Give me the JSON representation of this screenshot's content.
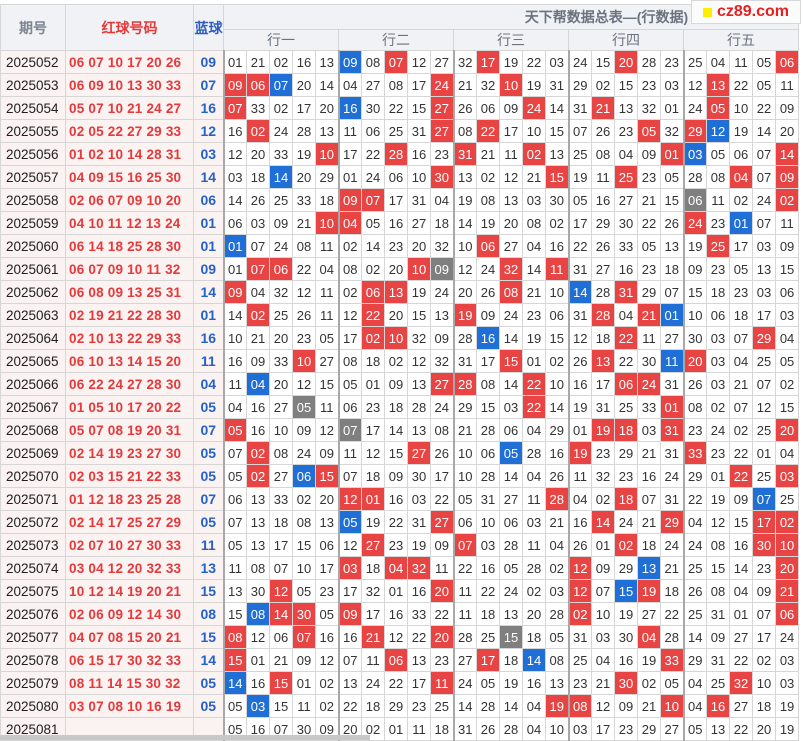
{
  "logo_text": "cz89.com",
  "header": {
    "period": "期号",
    "reds": "红球号码",
    "blue": "蓝球",
    "title": "天下帮数据总表—(行数据)",
    "groups": [
      "行一",
      "行二",
      "行三",
      "行四",
      "行五"
    ]
  },
  "rows": [
    {
      "period": "2025052",
      "reds": "06 07 10 17 20 26",
      "blue": "09",
      "cells": [
        "01",
        "21",
        "02",
        "16",
        "13",
        "09",
        "08",
        "07",
        "12",
        "27",
        "32",
        "17",
        "19",
        "22",
        "03",
        "24",
        "15",
        "20",
        "28",
        "23",
        "25",
        "04",
        "11",
        "05",
        "06"
      ],
      "marks": {
        "5": "b",
        "7": "r",
        "11": "r",
        "17": "r",
        "24": "r"
      }
    },
    {
      "period": "2025053",
      "reds": "06 09 10 13 30 33",
      "blue": "07",
      "cells": [
        "09",
        "06",
        "07",
        "20",
        "14",
        "04",
        "27",
        "08",
        "17",
        "24",
        "21",
        "32",
        "10",
        "19",
        "31",
        "29",
        "02",
        "15",
        "23",
        "03",
        "12",
        "13",
        "22",
        "05",
        "11"
      ],
      "marks": {
        "0": "r",
        "1": "r",
        "2": "b",
        "9": "r",
        "12": "r",
        "21": "r"
      }
    },
    {
      "period": "2025054",
      "reds": "05 07 10 21 24 27",
      "blue": "16",
      "cells": [
        "07",
        "33",
        "02",
        "17",
        "20",
        "16",
        "30",
        "22",
        "15",
        "27",
        "26",
        "06",
        "09",
        "24",
        "14",
        "31",
        "21",
        "13",
        "32",
        "01",
        "24",
        "05",
        "10",
        "22",
        "09"
      ],
      "marks": {
        "0": "r",
        "5": "b",
        "9": "r",
        "13": "r",
        "16": "r",
        "21": "r"
      }
    },
    {
      "period": "2025055",
      "reds": "02 05 22 27 29 33",
      "blue": "12",
      "cells": [
        "16",
        "02",
        "24",
        "28",
        "13",
        "11",
        "06",
        "25",
        "31",
        "27",
        "08",
        "22",
        "17",
        "10",
        "15",
        "07",
        "26",
        "23",
        "05",
        "32",
        "29",
        "12",
        "19",
        "14",
        "20"
      ],
      "marks": {
        "1": "r",
        "9": "r",
        "11": "r",
        "18": "r",
        "20": "r",
        "21": "b"
      }
    },
    {
      "period": "2025056",
      "reds": "01 02 10 14 28 31",
      "blue": "03",
      "cells": [
        "12",
        "20",
        "33",
        "19",
        "10",
        "17",
        "22",
        "28",
        "16",
        "23",
        "31",
        "21",
        "11",
        "02",
        "13",
        "25",
        "08",
        "04",
        "09",
        "01",
        "03",
        "05",
        "06",
        "07",
        "14"
      ],
      "marks": {
        "4": "r",
        "7": "r",
        "10": "r",
        "13": "r",
        "19": "r",
        "20": "b",
        "24": "r"
      }
    },
    {
      "period": "2025057",
      "reds": "04 09 15 16 25 30",
      "blue": "14",
      "cells": [
        "03",
        "18",
        "14",
        "20",
        "29",
        "01",
        "24",
        "06",
        "10",
        "30",
        "13",
        "02",
        "12",
        "21",
        "15",
        "19",
        "11",
        "25",
        "23",
        "05",
        "28",
        "08",
        "04",
        "07",
        "09"
      ],
      "marks": {
        "2": "b",
        "9": "r",
        "14": "r",
        "17": "r",
        "22": "r",
        "24": "r"
      }
    },
    {
      "period": "2025058",
      "reds": "02 06 07 09 10 20",
      "blue": "06",
      "cells": [
        "14",
        "26",
        "25",
        "33",
        "18",
        "09",
        "07",
        "17",
        "31",
        "04",
        "19",
        "08",
        "13",
        "03",
        "30",
        "05",
        "16",
        "27",
        "21",
        "15",
        "06",
        "11",
        "02",
        "24",
        "02"
      ],
      "marks": {
        "5": "r",
        "6": "r",
        "20": "g",
        "24": "r"
      }
    },
    {
      "period": "2025059",
      "reds": "04 10 11 12 13 24",
      "blue": "01",
      "cells": [
        "06",
        "03",
        "09",
        "21",
        "10",
        "04",
        "05",
        "16",
        "27",
        "18",
        "14",
        "19",
        "20",
        "08",
        "02",
        "17",
        "29",
        "30",
        "22",
        "26",
        "24",
        "23",
        "01",
        "07",
        "11"
      ],
      "marks": {
        "4": "r",
        "5": "r",
        "20": "r",
        "22": "b"
      }
    },
    {
      "period": "2025060",
      "reds": "06 14 18 25 28 30",
      "blue": "01",
      "cells": [
        "01",
        "07",
        "24",
        "08",
        "11",
        "02",
        "14",
        "23",
        "20",
        "32",
        "10",
        "06",
        "27",
        "04",
        "16",
        "22",
        "26",
        "33",
        "05",
        "13",
        "19",
        "25",
        "17",
        "03",
        "09"
      ],
      "marks": {
        "0": "b",
        "11": "r",
        "21": "r"
      }
    },
    {
      "period": "2025061",
      "reds": "06 07 09 10 11 32",
      "blue": "09",
      "cells": [
        "01",
        "07",
        "06",
        "22",
        "04",
        "08",
        "02",
        "20",
        "10",
        "09",
        "12",
        "24",
        "32",
        "14",
        "11",
        "31",
        "27",
        "16",
        "23",
        "18",
        "09",
        "23",
        "05",
        "13",
        "15"
      ],
      "marks": {
        "1": "r",
        "2": "r",
        "8": "r",
        "9": "g",
        "12": "r",
        "14": "r"
      }
    },
    {
      "period": "2025062",
      "reds": "06 08 09 13 25 31",
      "blue": "14",
      "cells": [
        "09",
        "04",
        "32",
        "12",
        "11",
        "02",
        "06",
        "13",
        "19",
        "24",
        "20",
        "26",
        "08",
        "21",
        "10",
        "14",
        "28",
        "31",
        "29",
        "07",
        "15",
        "18",
        "23",
        "03",
        "06"
      ],
      "marks": {
        "0": "r",
        "6": "r",
        "7": "r",
        "12": "r",
        "15": "b",
        "17": "r"
      }
    },
    {
      "period": "2025063",
      "reds": "02 19 21 22 28 30",
      "blue": "01",
      "cells": [
        "14",
        "02",
        "25",
        "26",
        "11",
        "12",
        "22",
        "20",
        "15",
        "13",
        "19",
        "09",
        "24",
        "23",
        "06",
        "31",
        "28",
        "04",
        "21",
        "01",
        "10",
        "06",
        "18",
        "17",
        "03"
      ],
      "marks": {
        "1": "r",
        "6": "r",
        "10": "r",
        "16": "r",
        "18": "r",
        "19": "b"
      }
    },
    {
      "period": "2025064",
      "reds": "02 10 13 22 29 33",
      "blue": "16",
      "cells": [
        "10",
        "21",
        "20",
        "23",
        "05",
        "17",
        "02",
        "10",
        "32",
        "09",
        "28",
        "16",
        "14",
        "19",
        "15",
        "12",
        "18",
        "22",
        "11",
        "27",
        "30",
        "03",
        "07",
        "29",
        "04"
      ],
      "marks": {
        "6": "r",
        "7": "r",
        "11": "b",
        "17": "r",
        "23": "r"
      }
    },
    {
      "period": "2025065",
      "reds": "06 10 13 14 15 20",
      "blue": "11",
      "cells": [
        "16",
        "09",
        "33",
        "10",
        "27",
        "08",
        "18",
        "02",
        "12",
        "32",
        "31",
        "17",
        "15",
        "01",
        "02",
        "26",
        "13",
        "22",
        "30",
        "11",
        "20",
        "03",
        "04",
        "25",
        "05"
      ],
      "marks": {
        "3": "r",
        "12": "r",
        "16": "r",
        "19": "b",
        "20": "r"
      }
    },
    {
      "period": "2025066",
      "reds": "06 22 24 27 28 30",
      "blue": "04",
      "cells": [
        "11",
        "04",
        "20",
        "12",
        "15",
        "05",
        "01",
        "09",
        "13",
        "27",
        "28",
        "08",
        "14",
        "22",
        "10",
        "16",
        "17",
        "06",
        "24",
        "31",
        "26",
        "03",
        "21",
        "07",
        "02"
      ],
      "marks": {
        "1": "b",
        "9": "r",
        "10": "r",
        "13": "r",
        "17": "r",
        "18": "r"
      }
    },
    {
      "period": "2025067",
      "reds": "01 05 10 17 20 22",
      "blue": "05",
      "cells": [
        "04",
        "16",
        "27",
        "05",
        "11",
        "06",
        "23",
        "18",
        "28",
        "24",
        "29",
        "15",
        "03",
        "22",
        "14",
        "19",
        "31",
        "25",
        "33",
        "01",
        "08",
        "02",
        "07",
        "12",
        "15"
      ],
      "marks": {
        "3": "g",
        "13": "r",
        "19": "r"
      }
    },
    {
      "period": "2025068",
      "reds": "05 07 08 19 20 31",
      "blue": "07",
      "cells": [
        "05",
        "16",
        "10",
        "09",
        "12",
        "07",
        "17",
        "14",
        "13",
        "08",
        "21",
        "28",
        "06",
        "04",
        "29",
        "01",
        "19",
        "18",
        "03",
        "31",
        "23",
        "24",
        "02",
        "25",
        "20"
      ],
      "marks": {
        "0": "r",
        "5": "g",
        "16": "r",
        "17": "r",
        "19": "r",
        "24": "r"
      }
    },
    {
      "period": "2025069",
      "reds": "02 14 19 23 27 30",
      "blue": "05",
      "cells": [
        "07",
        "02",
        "08",
        "24",
        "09",
        "11",
        "12",
        "15",
        "27",
        "26",
        "10",
        "06",
        "05",
        "28",
        "16",
        "19",
        "23",
        "29",
        "21",
        "31",
        "33",
        "23",
        "22",
        "01",
        "04"
      ],
      "marks": {
        "1": "r",
        "8": "r",
        "12": "b",
        "15": "r",
        "20": "r"
      }
    },
    {
      "period": "2025070",
      "reds": "02 03 15 21 22 33",
      "blue": "05",
      "cells": [
        "05",
        "02",
        "27",
        "06",
        "15",
        "07",
        "18",
        "09",
        "30",
        "17",
        "10",
        "28",
        "14",
        "04",
        "26",
        "11",
        "32",
        "23",
        "16",
        "24",
        "29",
        "01",
        "22",
        "25",
        "03"
      ],
      "marks": {
        "1": "r",
        "3": "b",
        "4": "r",
        "22": "r",
        "24": "r"
      }
    },
    {
      "period": "2025071",
      "reds": "01 12 18 23 25 28",
      "blue": "07",
      "cells": [
        "06",
        "13",
        "33",
        "02",
        "20",
        "12",
        "01",
        "16",
        "03",
        "22",
        "05",
        "31",
        "27",
        "11",
        "28",
        "04",
        "02",
        "18",
        "07",
        "31",
        "22",
        "19",
        "09",
        "07",
        "25"
      ],
      "marks": {
        "5": "r",
        "6": "r",
        "14": "r",
        "17": "r",
        "23": "b"
      }
    },
    {
      "period": "2025072",
      "reds": "02 14 17 25 27 29",
      "blue": "05",
      "cells": [
        "07",
        "13",
        "18",
        "08",
        "13",
        "05",
        "19",
        "22",
        "31",
        "27",
        "06",
        "10",
        "06",
        "03",
        "21",
        "16",
        "14",
        "24",
        "21",
        "29",
        "04",
        "12",
        "15",
        "17",
        "02"
      ],
      "marks": {
        "5": "b",
        "9": "r",
        "16": "r",
        "19": "r",
        "23": "r",
        "24": "r"
      }
    },
    {
      "period": "2025073",
      "reds": "02 07 10 27 30 33",
      "blue": "11",
      "cells": [
        "05",
        "13",
        "17",
        "15",
        "06",
        "12",
        "27",
        "23",
        "19",
        "09",
        "07",
        "03",
        "28",
        "11",
        "04",
        "26",
        "01",
        "02",
        "18",
        "24",
        "24",
        "08",
        "16",
        "30",
        "10"
      ],
      "marks": {
        "6": "r",
        "10": "r",
        "17": "r",
        "23": "r",
        "24": "r"
      }
    },
    {
      "period": "2025074",
      "reds": "03 04 12 20 32 33",
      "blue": "13",
      "cells": [
        "11",
        "08",
        "07",
        "10",
        "17",
        "03",
        "18",
        "04",
        "32",
        "11",
        "22",
        "16",
        "05",
        "28",
        "02",
        "12",
        "09",
        "29",
        "13",
        "21",
        "25",
        "15",
        "14",
        "23",
        "20"
      ],
      "marks": {
        "5": "r",
        "7": "r",
        "8": "r",
        "15": "r",
        "18": "b",
        "24": "r"
      }
    },
    {
      "period": "2025075",
      "reds": "10 12 14 19 20 21",
      "blue": "15",
      "cells": [
        "13",
        "30",
        "12",
        "05",
        "23",
        "17",
        "32",
        "01",
        "16",
        "20",
        "11",
        "22",
        "24",
        "02",
        "03",
        "12",
        "07",
        "15",
        "19",
        "18",
        "26",
        "08",
        "04",
        "09",
        "21"
      ],
      "marks": {
        "2": "r",
        "9": "r",
        "15": "r",
        "17": "b",
        "18": "r",
        "24": "r"
      }
    },
    {
      "period": "2025076",
      "reds": "02 06 09 12 14 30",
      "blue": "08",
      "cells": [
        "15",
        "08",
        "14",
        "30",
        "05",
        "09",
        "17",
        "16",
        "33",
        "22",
        "11",
        "18",
        "13",
        "20",
        "28",
        "02",
        "10",
        "19",
        "27",
        "22",
        "25",
        "31",
        "01",
        "07",
        "06"
      ],
      "marks": {
        "1": "b",
        "2": "r",
        "3": "r",
        "5": "r",
        "15": "r",
        "24": "r"
      }
    },
    {
      "period": "2025077",
      "reds": "04 07 08 15 20 21",
      "blue": "15",
      "cells": [
        "08",
        "12",
        "06",
        "07",
        "16",
        "16",
        "21",
        "12",
        "22",
        "20",
        "28",
        "25",
        "15",
        "18",
        "05",
        "31",
        "03",
        "30",
        "04",
        "28",
        "14",
        "09",
        "27",
        "17",
        "24"
      ],
      "marks": {
        "0": "r",
        "3": "r",
        "6": "r",
        "9": "r",
        "12": "g",
        "18": "r"
      }
    },
    {
      "period": "2025078",
      "reds": "06 15 17 30 32 33",
      "blue": "14",
      "cells": [
        "15",
        "01",
        "21",
        "09",
        "12",
        "07",
        "11",
        "06",
        "13",
        "23",
        "27",
        "17",
        "18",
        "14",
        "08",
        "25",
        "04",
        "16",
        "19",
        "33",
        "29",
        "31",
        "22",
        "02",
        "03"
      ],
      "marks": {
        "0": "r",
        "7": "r",
        "11": "r",
        "13": "b",
        "19": "r"
      }
    },
    {
      "period": "2025079",
      "reds": "08 11 14 15 30 32",
      "blue": "05",
      "cells": [
        "14",
        "16",
        "15",
        "01",
        "02",
        "13",
        "24",
        "22",
        "17",
        "11",
        "24",
        "05",
        "19",
        "16",
        "13",
        "23",
        "21",
        "30",
        "02",
        "05",
        "04",
        "25",
        "32",
        "10",
        "03"
      ],
      "marks": {
        "0": "b",
        "2": "r",
        "9": "r",
        "17": "r",
        "22": "r"
      }
    },
    {
      "period": "2025080",
      "reds": "03 07 08 10 16 19",
      "blue": "05",
      "cells": [
        "05",
        "03",
        "15",
        "11",
        "02",
        "22",
        "18",
        "29",
        "23",
        "25",
        "14",
        "28",
        "14",
        "04",
        "19",
        "08",
        "12",
        "09",
        "21",
        "10",
        "04",
        "16",
        "27",
        "18",
        "19"
      ],
      "marks": {
        "1": "b",
        "14": "r",
        "15": "r",
        "19": "r",
        "21": "r"
      }
    },
    {
      "period": "2025081",
      "reds": "",
      "blue": "",
      "cells": [
        "05",
        "16",
        "07",
        "30",
        "09",
        "20",
        "02",
        "01",
        "11",
        "18",
        "31",
        "26",
        "28",
        "04",
        "10",
        "03",
        "17",
        "23",
        "29",
        "27",
        "05",
        "13",
        "22",
        "20",
        "19"
      ],
      "marks": {}
    }
  ]
}
